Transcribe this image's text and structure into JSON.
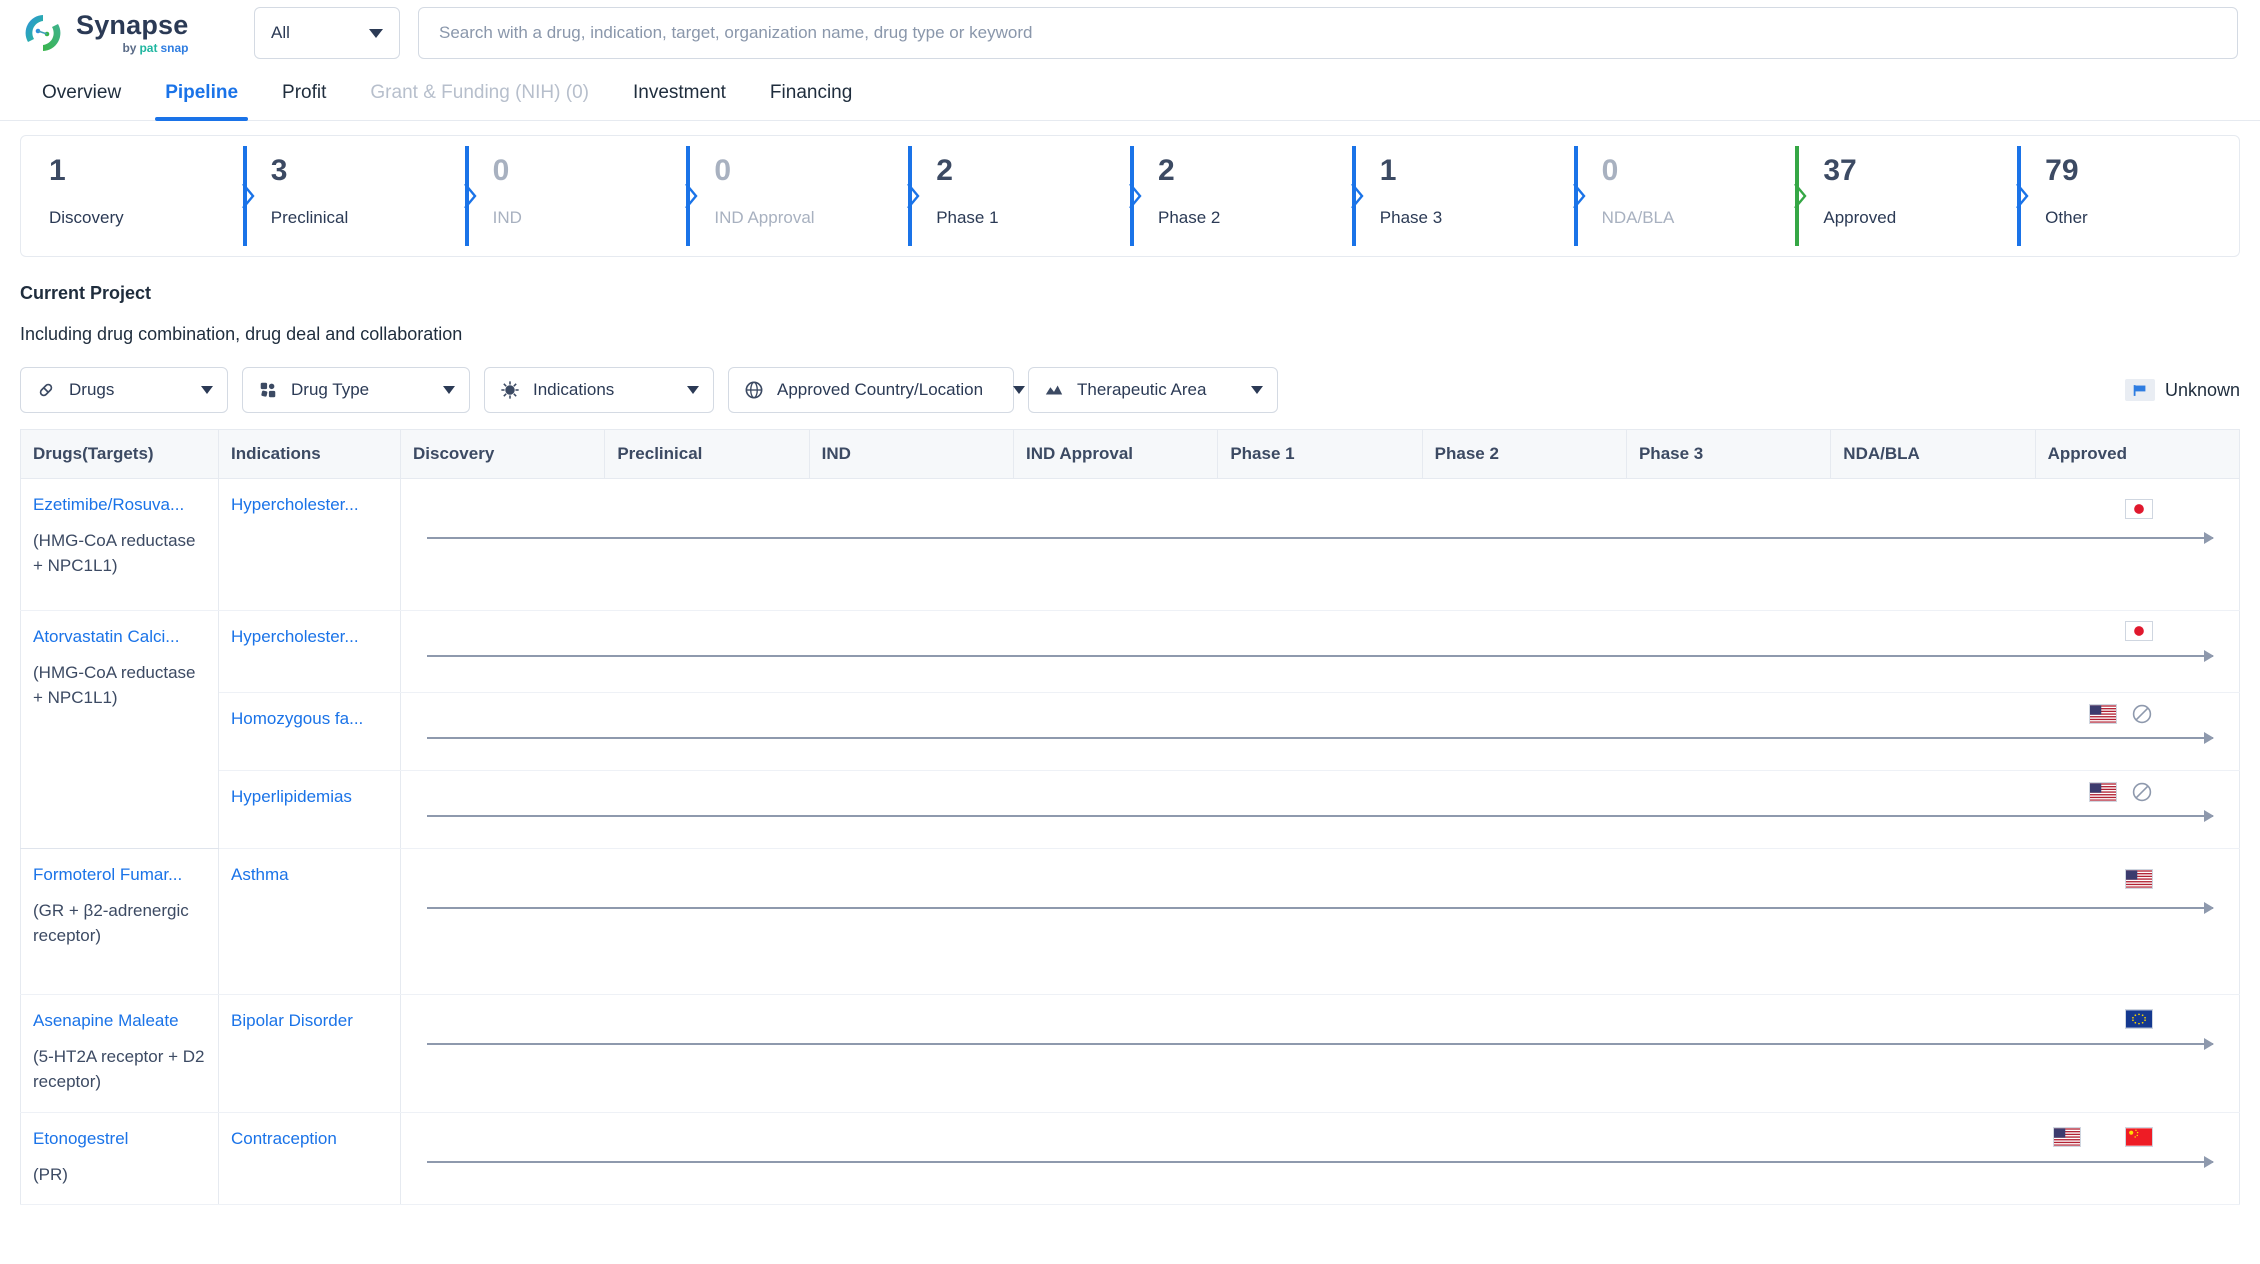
{
  "brand": {
    "name": "Synapse",
    "by": "by",
    "pat": "pat",
    "snap": "snap"
  },
  "header": {
    "scope_selected": "All",
    "search_placeholder": "Search with a drug, indication, target, organization name, drug type or keyword",
    "search_value": ""
  },
  "tabs": [
    {
      "label": "Overview",
      "state": "normal"
    },
    {
      "label": "Pipeline",
      "state": "active"
    },
    {
      "label": "Profit",
      "state": "normal"
    },
    {
      "label": "Grant & Funding (NIH) (0)",
      "state": "disabled"
    },
    {
      "label": "Investment",
      "state": "normal"
    },
    {
      "label": "Financing",
      "state": "normal"
    }
  ],
  "stats": [
    {
      "count": "1",
      "label": "Discovery",
      "zero": false,
      "color": "#1a73e8"
    },
    {
      "count": "3",
      "label": "Preclinical",
      "zero": false,
      "color": "#1a73e8"
    },
    {
      "count": "0",
      "label": "IND",
      "zero": true,
      "color": "#1a73e8"
    },
    {
      "count": "0",
      "label": "IND Approval",
      "zero": true,
      "color": "#1a73e8"
    },
    {
      "count": "2",
      "label": "Phase 1",
      "zero": false,
      "color": "#1a73e8"
    },
    {
      "count": "2",
      "label": "Phase 2",
      "zero": false,
      "color": "#1a73e8"
    },
    {
      "count": "1",
      "label": "Phase 3",
      "zero": false,
      "color": "#1a73e8"
    },
    {
      "count": "0",
      "label": "NDA/BLA",
      "zero": true,
      "color": "#1a73e8"
    },
    {
      "count": "37",
      "label": "Approved",
      "zero": false,
      "color": "#35a745"
    },
    {
      "count": "79",
      "label": "Other",
      "zero": false,
      "color": "#1a73e8"
    }
  ],
  "section": {
    "title": "Current Project",
    "subtitle": "Including drug combination, drug deal and collaboration"
  },
  "filters": [
    {
      "label": "Drugs",
      "icon": "pill-icon"
    },
    {
      "label": "Drug Type",
      "icon": "molecule-icon"
    },
    {
      "label": "Indications",
      "icon": "virus-icon"
    },
    {
      "label": "Approved Country/Location",
      "icon": "globe-icon"
    },
    {
      "label": "Therapeutic Area",
      "icon": "mountain-icon"
    }
  ],
  "legend": {
    "label": "Unknown",
    "icon": "flag-icon"
  },
  "table": {
    "columns": [
      "Drugs(Targets)",
      "Indications",
      "Discovery",
      "Preclinical",
      "IND",
      "IND Approval",
      "Phase 1",
      "Phase 2",
      "Phase 3",
      "NDA/BLA",
      "Approved"
    ],
    "rows": [
      {
        "drug": "Ezetimibe/Rosuva...",
        "targets": "(HMG-CoA reductase + NPC1L1)",
        "indications": [
          {
            "name": "Hypercholester...",
            "flags": [
              "japan"
            ],
            "blocked": false
          }
        ]
      },
      {
        "drug": "Atorvastatin Calci...",
        "targets": "(HMG-CoA reductase + NPC1L1)",
        "indications": [
          {
            "name": "Hypercholester...",
            "flags": [
              "japan"
            ],
            "blocked": false
          },
          {
            "name": "Homozygous fa...",
            "flags": [
              "usa"
            ],
            "blocked": true
          },
          {
            "name": "Hyperlipidemias",
            "flags": [
              "usa"
            ],
            "blocked": true
          }
        ]
      },
      {
        "drug": "Formoterol Fumar...",
        "targets": "(GR + β2-adrenergic receptor)",
        "indications": [
          {
            "name": "Asthma",
            "flags": [
              "usa"
            ],
            "blocked": false
          }
        ]
      },
      {
        "drug": "Asenapine Maleate",
        "targets": "(5-HT2A receptor + D2 receptor)",
        "indications": [
          {
            "name": "Bipolar Disorder",
            "flags": [
              "eu"
            ],
            "blocked": false
          }
        ]
      },
      {
        "drug": "Etonogestrel",
        "targets": "(PR)",
        "indications": [
          {
            "name": "Contraception",
            "flags": [
              "usa",
              "china"
            ],
            "blocked": false
          }
        ]
      }
    ]
  },
  "colors": {
    "accent": "#1a73e8",
    "approved_green": "#35a745",
    "text": "#1f2d3d",
    "muted": "#a8b1c0",
    "border": "#e6eaf0",
    "track": "#8e99ad"
  }
}
